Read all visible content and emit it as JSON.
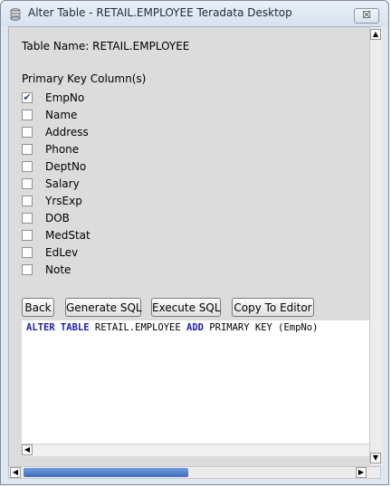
{
  "window": {
    "title": "Alter Table - RETAIL.EMPLOYEE Teradata Desktop",
    "close_glyph": "☒"
  },
  "form": {
    "table_name": "Table Name: RETAIL.EMPLOYEE",
    "pk_header": "Primary Key Column(s)",
    "columns": [
      {
        "label": "EmpNo",
        "checked": true
      },
      {
        "label": "Name",
        "checked": false
      },
      {
        "label": "Address",
        "checked": false
      },
      {
        "label": "Phone",
        "checked": false
      },
      {
        "label": "DeptNo",
        "checked": false
      },
      {
        "label": "Salary",
        "checked": false
      },
      {
        "label": "YrsExp",
        "checked": false
      },
      {
        "label": "DOB",
        "checked": false
      },
      {
        "label": "MedStat",
        "checked": false
      },
      {
        "label": "EdLev",
        "checked": false
      },
      {
        "label": "Note",
        "checked": false
      }
    ]
  },
  "buttons": {
    "back": "Back",
    "generate_sql": "Generate SQL",
    "execute_sql": "Execute SQL",
    "copy_to_editor": "Copy To Editor"
  },
  "sql": {
    "kw1": "ALTER TABLE",
    "text1": " RETAIL.EMPLOYEE ",
    "kw2": "ADD",
    "text2": " PRIMARY KEY (EmpNo)"
  },
  "icons": {
    "app": "teradata-app-icon",
    "close": "close-icon",
    "scroll_up": "scroll-up-arrow-icon",
    "scroll_down": "scroll-down-arrow-icon",
    "scroll_left": "scroll-left-arrow-icon",
    "scroll_right": "scroll-right-arrow-icon"
  },
  "colors": {
    "keyword": "#1d1db3",
    "scroll_thumb": "#3f6dbd"
  }
}
